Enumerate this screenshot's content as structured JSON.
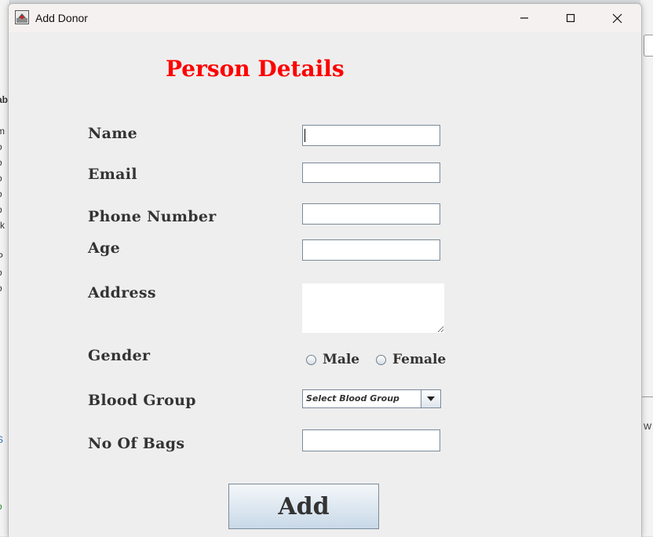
{
  "window": {
    "title": "Add Donor"
  },
  "form": {
    "heading": "Person Details",
    "labels": {
      "name": "Name",
      "email": "Email",
      "phone": "Phone Number",
      "age": "Age",
      "address": "Address",
      "gender": "Gender",
      "blood_group": "Blood Group",
      "bags": "No Of Bags"
    },
    "values": {
      "name": "",
      "email": "",
      "phone": "",
      "age": "",
      "address": "",
      "bags": ""
    },
    "gender_options": {
      "male": "Male",
      "female": "Female"
    },
    "blood_group_selected": "Select Blood Group",
    "add_label": "Add"
  },
  "icons": {
    "app": "blood-donor-app-icon",
    "minimize": "minimize-icon",
    "maximize": "maximize-icon",
    "close": "close-icon",
    "dropdown": "chevron-down-icon"
  },
  "colors": {
    "heading": "#ff0000",
    "label": "#333333",
    "window_bg": "#eeeeee"
  }
}
